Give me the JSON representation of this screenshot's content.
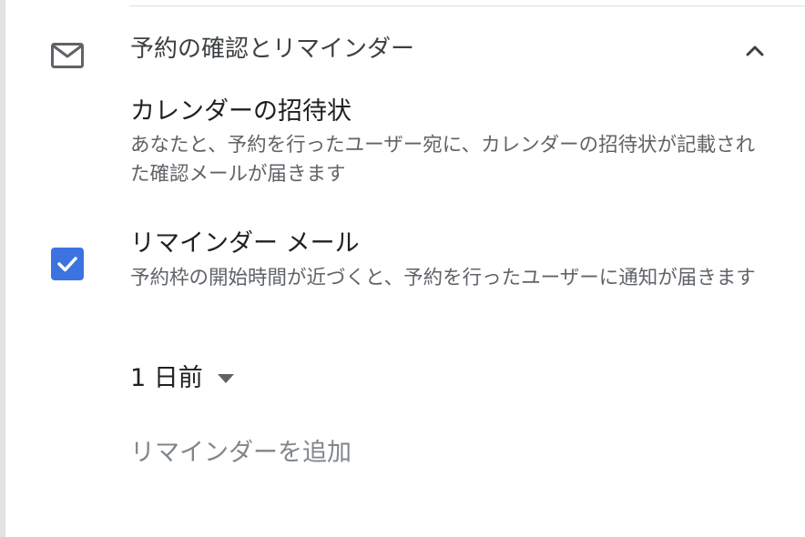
{
  "section": {
    "title": "予約の確認とリマインダー",
    "icon": "mail-icon",
    "collapse_icon": "chevron-up-icon",
    "expanded": true
  },
  "calendar_invite": {
    "title": "カレンダーの招待状",
    "description": "あなたと、予約を行ったユーザー宛に、カレンダーの招待状が記載された確認メールが届きます"
  },
  "reminder_email": {
    "title": "リマインダー メール",
    "description": "予約枠の開始時間が近づくと、予約を行ったユーザーに通知が届きます",
    "checked": true
  },
  "reminder_timing": {
    "selected": "1 日前",
    "icon": "dropdown-arrow-icon"
  },
  "add_reminder": {
    "label": "リマインダーを追加"
  },
  "colors": {
    "accent": "#3b73e0",
    "primary_text": "#202124",
    "secondary_text": "#5f6368",
    "disabled_text": "#80868b",
    "icon": "#5f6368"
  }
}
